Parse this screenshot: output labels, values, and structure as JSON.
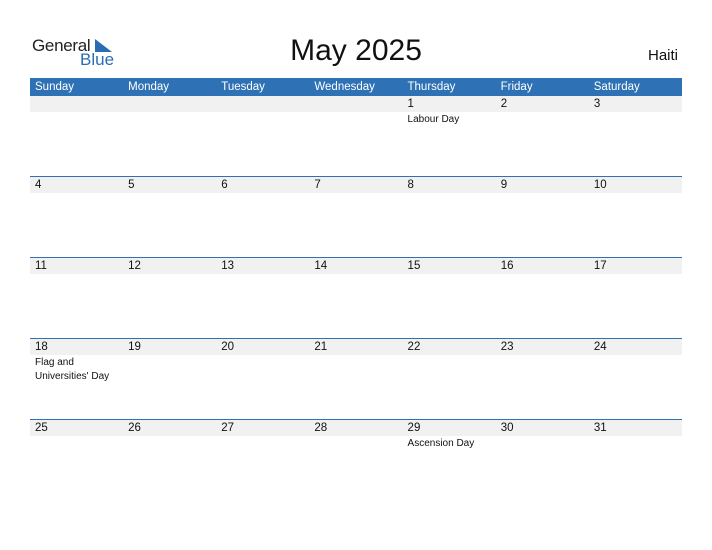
{
  "logo": {
    "general": "General",
    "blue": "Blue"
  },
  "title": "May 2025",
  "country": "Haiti",
  "days": [
    "Sunday",
    "Monday",
    "Tuesday",
    "Wednesday",
    "Thursday",
    "Friday",
    "Saturday"
  ],
  "weeks": [
    [
      {
        "d": ""
      },
      {
        "d": ""
      },
      {
        "d": ""
      },
      {
        "d": ""
      },
      {
        "d": "1",
        "e": "Labour Day"
      },
      {
        "d": "2"
      },
      {
        "d": "3"
      }
    ],
    [
      {
        "d": "4"
      },
      {
        "d": "5"
      },
      {
        "d": "6"
      },
      {
        "d": "7"
      },
      {
        "d": "8"
      },
      {
        "d": "9"
      },
      {
        "d": "10"
      }
    ],
    [
      {
        "d": "11"
      },
      {
        "d": "12"
      },
      {
        "d": "13"
      },
      {
        "d": "14"
      },
      {
        "d": "15"
      },
      {
        "d": "16"
      },
      {
        "d": "17"
      }
    ],
    [
      {
        "d": "18",
        "e": "Flag and Universities' Day"
      },
      {
        "d": "19"
      },
      {
        "d": "20"
      },
      {
        "d": "21"
      },
      {
        "d": "22"
      },
      {
        "d": "23"
      },
      {
        "d": "24"
      }
    ],
    [
      {
        "d": "25"
      },
      {
        "d": "26"
      },
      {
        "d": "27"
      },
      {
        "d": "28"
      },
      {
        "d": "29",
        "e": "Ascension Day"
      },
      {
        "d": "30"
      },
      {
        "d": "31"
      }
    ]
  ]
}
